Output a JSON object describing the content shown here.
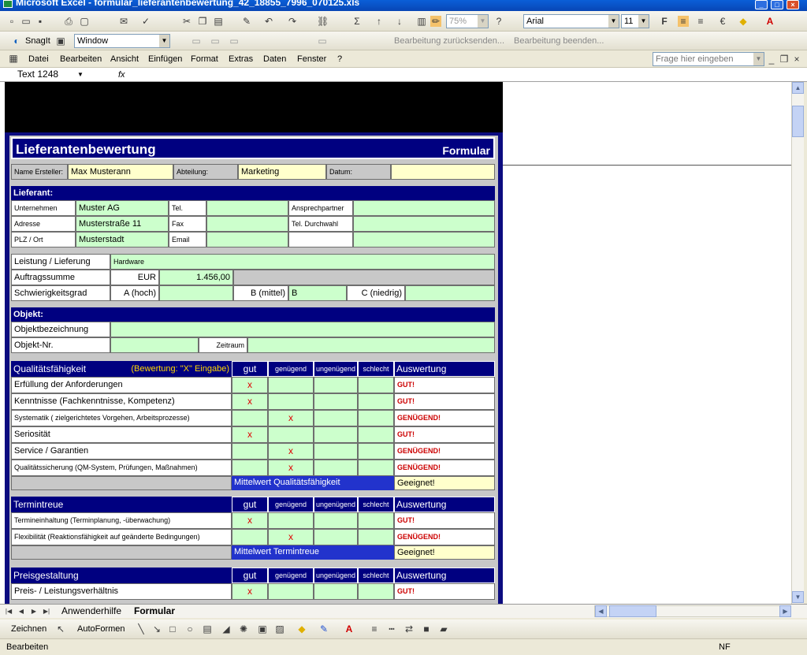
{
  "window": {
    "title": "Microsoft Excel - formular_lieferantenbewertung_42_18855_7996_070125.xls"
  },
  "font_toolbar": {
    "font_name": "Arial",
    "font_size": "11",
    "zoom": "75%"
  },
  "snagit_toolbar": {
    "snagit_label": "SnagIt",
    "window_label": "Window",
    "reply_changes": "Bearbeitung zurücksenden...",
    "end_review": "Bearbeitung beenden..."
  },
  "menu": {
    "items": [
      "Datei",
      "Bearbeiten",
      "Ansicht",
      "Einfügen",
      "Format",
      "Extras",
      "Daten",
      "Fenster",
      "?"
    ],
    "help_placeholder": "Frage hier eingeben"
  },
  "formula_bar": {
    "name_box": "Text 1248",
    "fx": "fx"
  },
  "form": {
    "title": "Lieferantenbewertung",
    "subtitle": "Formular",
    "creator_label": "Name Ersteller:",
    "creator_value": "Max Musterann",
    "department_label": "Abteilung:",
    "department_value": "Marketing",
    "date_label": "Datum:",
    "date_value": "",
    "supplier": {
      "header": "Lieferant:",
      "company_label": "Unternehmen",
      "company_value": "Muster AG",
      "phone_label": "Tel.",
      "contact_label": "Ansprechpartner",
      "address_label": "Adresse",
      "address_value": "Musterstraße 11",
      "fax_label": "Fax",
      "direct_label": "Tel. Durchwahl",
      "city_label": "PLZ / Ort",
      "city_value": "Musterstadt",
      "email_label": "Email"
    },
    "service": {
      "label": "Leistung / Lieferung",
      "value": "Hardware",
      "order_label": "Auftragssumme",
      "currency": "EUR",
      "amount": "1.456,00",
      "difficulty_label": "Schwierigkeitsgrad",
      "level_a": "A (hoch)",
      "level_b": "B (mittel)",
      "level_b_value": "B",
      "level_c": "C (niedrig)"
    },
    "object": {
      "header": "Objekt:",
      "name_label": "Objektbezeichnung",
      "number_label": "Objekt-Nr.",
      "period_label": "Zeitraum"
    },
    "col_gut": "gut",
    "col_genuegend": "genügend",
    "col_ungenuegend": "ungenügend",
    "col_schlecht": "schlecht",
    "col_auswertung": "Auswertung",
    "quality": {
      "header": "Qualitätsfähigkeit",
      "hint": "(Bewertung: \"X\" Eingabe)",
      "rows": [
        {
          "label": "Erfüllung der Anforderungen",
          "mark_col": 0,
          "mark": "x",
          "result": "GUT!"
        },
        {
          "label": "Kenntnisse (Fachkenntnisse, Kompetenz)",
          "mark_col": 0,
          "mark": "x",
          "result": "GUT!"
        },
        {
          "label": "Systematik ( zielgerichtetes Vorgehen, Arbeitsprozesse)",
          "mark_col": 1,
          "mark": "x",
          "result": "GENÜGEND!"
        },
        {
          "label": "Seriosität",
          "mark_col": 0,
          "mark": "x",
          "result": "GUT!"
        },
        {
          "label": "Service / Garantien",
          "mark_col": 1,
          "mark": "x",
          "result": "GENÜGEND!"
        },
        {
          "label": "Qualitätssicherung (QM-System, Prüfungen, Maßnahmen)",
          "mark_col": 1,
          "mark": "x",
          "result": "GENÜGEND!"
        }
      ],
      "avg_label": "Mittelwert Qualitätsfähigkeit",
      "avg_value": "Geeignet!"
    },
    "deadline": {
      "header": "Termintreue",
      "rows": [
        {
          "label": "Termineinhaltung (Terminplanung, -überwachung)",
          "mark_col": 0,
          "mark": "x",
          "result": "GUT!"
        },
        {
          "label": "Flexibilität (Reaktionsfähigkeit auf geänderte Bedingungen)",
          "mark_col": 1,
          "mark": "x",
          "result": "GENÜGEND!"
        }
      ],
      "avg_label": "Mittelwert Termintreue",
      "avg_value": "Geeignet!"
    },
    "price": {
      "header": "Preisgestaltung",
      "rows": [
        {
          "label": "Preis- / Leistungsverhältnis",
          "mark_col": 0,
          "mark": "x",
          "result": "GUT!"
        }
      ]
    }
  },
  "sheet_tabs": [
    "Anwenderhilfe",
    "Formular"
  ],
  "draw_toolbar": {
    "draw_label": "Zeichnen",
    "autoshapes_label": "AutoFormen"
  },
  "status": {
    "mode": "Bearbeiten",
    "nf": "NF"
  }
}
